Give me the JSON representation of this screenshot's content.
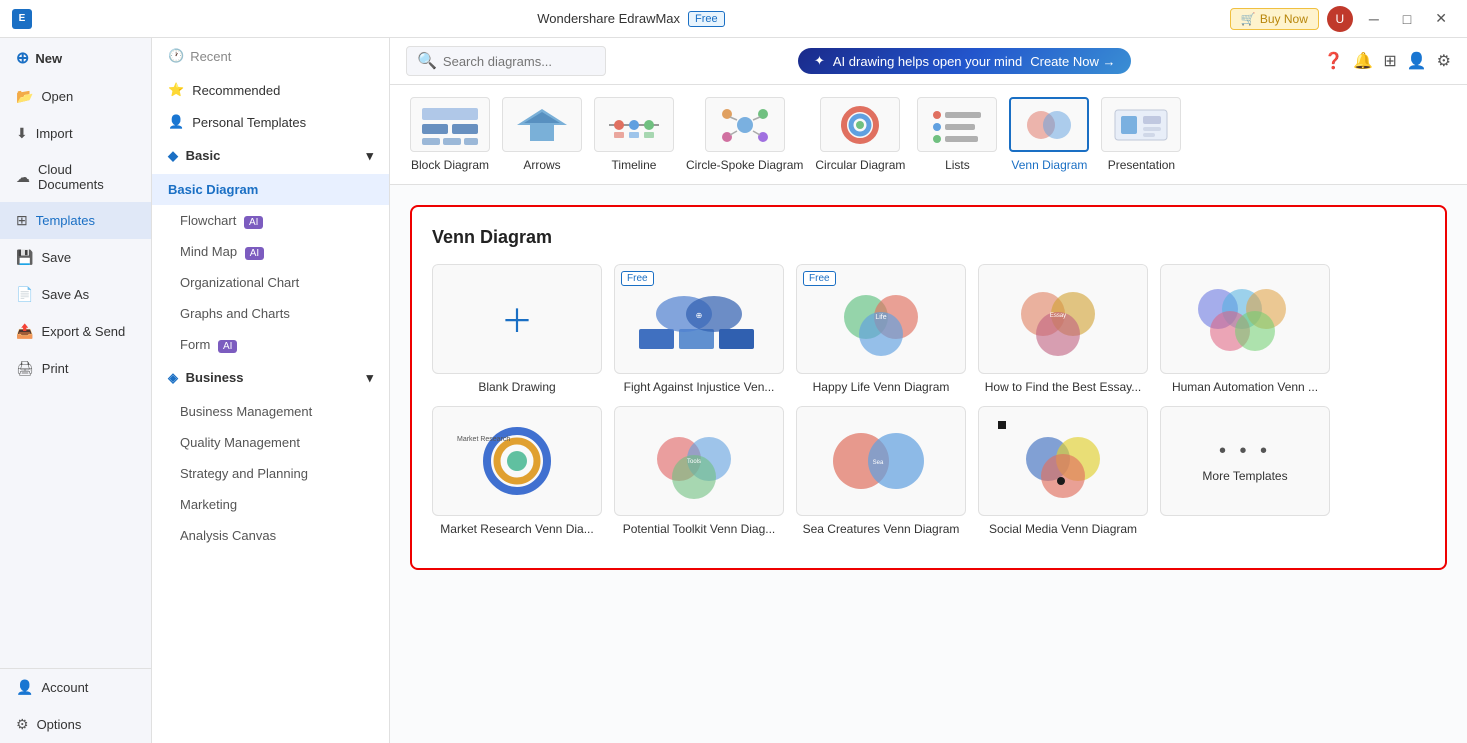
{
  "titleBar": {
    "appName": "Wondershare EdrawMax",
    "freeBadge": "Free",
    "buyNowLabel": "Buy Now",
    "minBtn": "─",
    "maxBtn": "□",
    "closeBtn": "✕"
  },
  "sidebar": {
    "newLabel": "New",
    "openLabel": "Open",
    "importLabel": "Import",
    "cloudDocumentsLabel": "Cloud Documents",
    "templatesLabel": "Templates",
    "saveLabel": "Save",
    "saveAsLabel": "Save As",
    "exportSendLabel": "Export & Send",
    "printLabel": "Print",
    "accountLabel": "Account",
    "optionsLabel": "Options"
  },
  "midPanel": {
    "recentLabel": "Recent",
    "recommendedLabel": "Recommended",
    "personalTemplatesLabel": "Personal Templates",
    "basicLabel": "Basic",
    "basicDiagramLabel": "Basic Diagram",
    "flowchartLabel": "Flowchart",
    "mindMapLabel": "Mind Map",
    "orgChartLabel": "Organizational Chart",
    "graphsChartsLabel": "Graphs and Charts",
    "formLabel": "Form",
    "businessLabel": "Business",
    "businessMgmtLabel": "Business Management",
    "qualityMgmtLabel": "Quality Management",
    "strategyLabel": "Strategy and Planning",
    "marketingLabel": "Marketing",
    "analysisLabel": "Analysis Canvas"
  },
  "topToolbar": {
    "searchPlaceholder": "Search diagrams...",
    "aiBannerText": "AI drawing helps open your mind",
    "createNowLabel": "Create Now →"
  },
  "diagramTypes": [
    {
      "label": "Block Diagram"
    },
    {
      "label": "Arrows"
    },
    {
      "label": "Timeline"
    },
    {
      "label": "Circle-Spoke Diagram"
    },
    {
      "label": "Circular Diagram"
    },
    {
      "label": "Lists"
    },
    {
      "label": "Venn Diagram",
      "selected": true
    },
    {
      "label": "Presentation"
    }
  ],
  "vennSection": {
    "title": "Venn Diagram",
    "templates": [
      {
        "name": "Blank Drawing",
        "type": "blank"
      },
      {
        "name": "Fight Against Injustice Ven...",
        "type": "venn1",
        "free": true
      },
      {
        "name": "Happy Life Venn Diagram",
        "type": "venn2",
        "free": true
      },
      {
        "name": "How to Find the Best Essay...",
        "type": "venn3"
      },
      {
        "name": "Human Automation Venn ...",
        "type": "venn4"
      },
      {
        "name": "Market Research Venn Dia...",
        "type": "venn5"
      },
      {
        "name": "Potential Toolkit Venn Diag...",
        "type": "venn6"
      },
      {
        "name": "Sea Creatures Venn Diagram",
        "type": "venn7"
      },
      {
        "name": "Social Media Venn Diagram",
        "type": "venn8"
      },
      {
        "name": "More Templates",
        "type": "more"
      }
    ]
  }
}
